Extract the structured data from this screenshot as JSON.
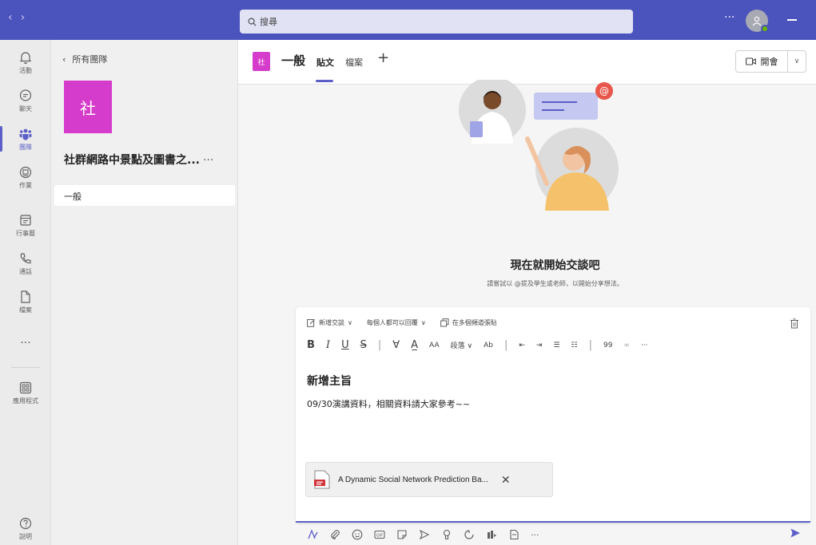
{
  "titlebar": {
    "search_placeholder": "搜尋",
    "more_label": "···"
  },
  "rail": {
    "items": [
      {
        "label": "活動",
        "icon": "bell-icon"
      },
      {
        "label": "聊天",
        "icon": "chat-icon"
      },
      {
        "label": "團隊",
        "icon": "teams-icon"
      },
      {
        "label": "作業",
        "icon": "assignments-icon"
      },
      {
        "label": "行事曆",
        "icon": "calendar-icon"
      },
      {
        "label": "通話",
        "icon": "phone-icon"
      },
      {
        "label": "檔案",
        "icon": "file-icon"
      }
    ],
    "more_label": "···",
    "apps_label": "應用程式",
    "help_label": "說明"
  },
  "team_pane": {
    "back_label": "所有團隊",
    "team_initial": "社",
    "team_name": "社群網路中景點及圖書之...",
    "team_more": "···",
    "channels": [
      "一般"
    ]
  },
  "channel": {
    "tile_initial": "社",
    "title": "一般",
    "tabs": [
      "貼文",
      "檔案"
    ],
    "meet_label": "開會"
  },
  "empty_state": {
    "title": "現在就開始交談吧",
    "subtitle": "請嘗試以 @提及學生或老師，以開始分享想法。"
  },
  "compose": {
    "options": [
      "新增交談",
      "每個人都可以回覆",
      "在多個頻道張貼"
    ],
    "format_paragraph": "段落",
    "subject": "新增主旨",
    "body": "09/30演講資料，相關資料請大家參考~~",
    "attachment_name": "A Dynamic Social Network Prediction Ba..."
  },
  "colors": {
    "brand": "#4b53bc",
    "accent": "#5b5fc7",
    "team_tile": "#d63ccb"
  }
}
